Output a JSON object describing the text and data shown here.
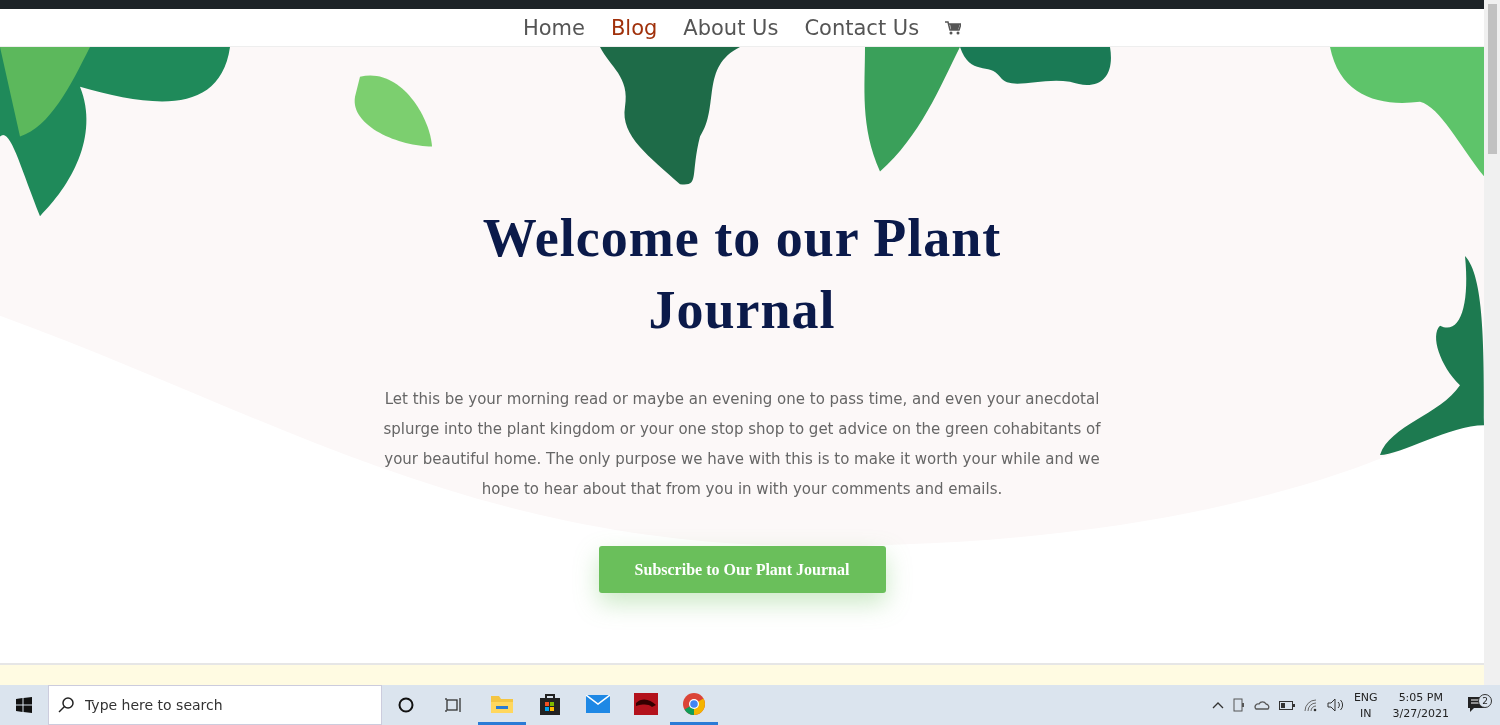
{
  "nav": {
    "items": [
      {
        "label": "Home",
        "selected": false
      },
      {
        "label": "Blog",
        "selected": true
      },
      {
        "label": "About Us",
        "selected": false
      },
      {
        "label": "Contact Us",
        "selected": false
      }
    ]
  },
  "hero": {
    "title": "Welcome to our Plant Journal",
    "body": "Let this be your morning read or maybe an evening one to pass time, and even your anecdotal splurge into the plant kingdom or your one stop shop to get advice on the green cohabitants of your beautiful home. The only purpose we have with this is to make it worth your while and we hope to hear about that from you in with your comments and emails.",
    "button": "Subscribe to Our Plant Journal"
  },
  "taskbar": {
    "search": {
      "placeholder": "Type here to search"
    },
    "apps": [
      {
        "kind": "folder",
        "running": true
      },
      {
        "kind": "store",
        "running": false
      },
      {
        "kind": "mail",
        "running": false
      },
      {
        "kind": "game",
        "running": false
      },
      {
        "kind": "browser",
        "running": true
      }
    ],
    "language": "ENG",
    "region": "IN",
    "time": "5:05 PM",
    "date": "3/27/2021",
    "notifications": "2"
  }
}
